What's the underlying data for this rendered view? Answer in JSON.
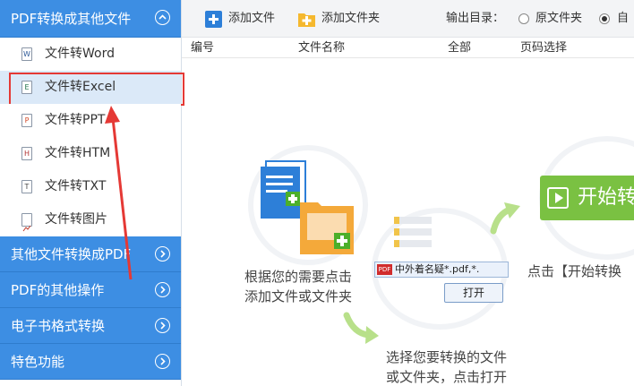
{
  "sidebar": {
    "categories": [
      {
        "label": "PDF转换成其他文件"
      },
      {
        "label": "其他文件转换成PDF"
      },
      {
        "label": "PDF的其他操作"
      },
      {
        "label": "电子书格式转换"
      },
      {
        "label": "特色功能"
      }
    ],
    "items": [
      {
        "label": "文件转Word",
        "icon": "W"
      },
      {
        "label": "文件转Excel",
        "icon": "E"
      },
      {
        "label": "文件转PPT",
        "icon": "P"
      },
      {
        "label": "文件转HTM",
        "icon": "H"
      },
      {
        "label": "文件转TXT",
        "icon": "T"
      },
      {
        "label": "文件转图片",
        "icon": "image"
      }
    ]
  },
  "toolbar": {
    "add_file": "添加文件",
    "add_folder": "添加文件夹",
    "output_label": "输出目录：",
    "option_original": "原文件夹",
    "option_custom": "自"
  },
  "table": {
    "columns": [
      "编号",
      "文件名称",
      "全部",
      "页码选择"
    ]
  },
  "guide": {
    "step1_line1": "根据您的需要点击",
    "step1_line2": "添加文件或文件夹",
    "step2_line1": "选择您要转换的文件",
    "step2_line2": "或文件夹，点击打开",
    "step3": "点击【开始转换",
    "start_button": "开始转",
    "dialog_filename": "中外着名疑",
    "dialog_filter": "*.pdf,*.",
    "dialog_open": "打开"
  },
  "colors": {
    "sidebar_blue": "#3d8ee3",
    "selected_bg": "#dbe9f8",
    "highlight_red": "#e53935",
    "start_green": "#7ac142"
  }
}
